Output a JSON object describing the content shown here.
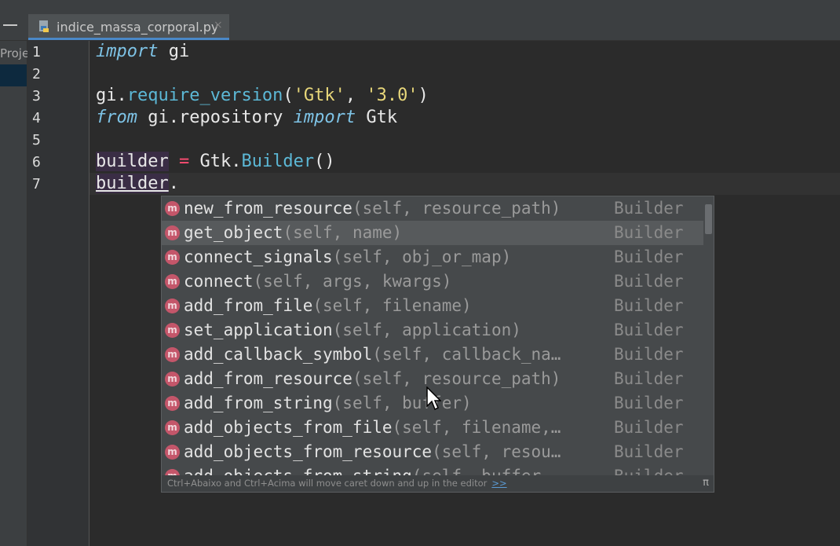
{
  "tab": {
    "filename": "indice_massa_corporal.py",
    "close": "×"
  },
  "sidebar": {
    "project_label": "Proje"
  },
  "editor": {
    "line_numbers": [
      "1",
      "2",
      "3",
      "4",
      "5",
      "6",
      "7"
    ],
    "lines": [
      [
        {
          "t": "import",
          "c": "kw"
        },
        {
          "t": " gi",
          "c": ""
        }
      ],
      [],
      [
        {
          "t": "gi.",
          "c": ""
        },
        {
          "t": "require_version",
          "c": "fn"
        },
        {
          "t": "(",
          "c": ""
        },
        {
          "t": "'Gtk'",
          "c": "str"
        },
        {
          "t": ", ",
          "c": ""
        },
        {
          "t": "'3.0'",
          "c": "str"
        },
        {
          "t": ")",
          "c": ""
        }
      ],
      [
        {
          "t": "from",
          "c": "kw"
        },
        {
          "t": " gi.repository ",
          "c": ""
        },
        {
          "t": "import",
          "c": "kw"
        },
        {
          "t": " Gtk",
          "c": ""
        }
      ],
      [],
      [
        {
          "t": "builder",
          "c": "var-hl"
        },
        {
          "t": " ",
          "c": ""
        },
        {
          "t": "=",
          "c": "op"
        },
        {
          "t": " Gtk.",
          "c": ""
        },
        {
          "t": "Builder",
          "c": "fn"
        },
        {
          "t": "()",
          "c": ""
        }
      ],
      [
        {
          "t": "builder",
          "c": "var-hl ul"
        },
        {
          "t": ".",
          "c": ""
        }
      ]
    ]
  },
  "completion": {
    "badge": "m",
    "items": [
      {
        "name": "new_from_resource",
        "params": "(self, resource_path)",
        "type": "Builder"
      },
      {
        "name": "get_object",
        "params": "(self, name)",
        "type": "Builder",
        "selected": true
      },
      {
        "name": "connect_signals",
        "params": "(self, obj_or_map)",
        "type": "Builder"
      },
      {
        "name": "connect",
        "params": "(self, args, kwargs)",
        "type": "Builder"
      },
      {
        "name": "add_from_file",
        "params": "(self, filename)",
        "type": "Builder"
      },
      {
        "name": "set_application",
        "params": "(self, application)",
        "type": "Builder"
      },
      {
        "name": "add_callback_symbol",
        "params": "(self, callback_na…",
        "type": "Builder"
      },
      {
        "name": "add_from_resource",
        "params": "(self, resource_path)",
        "type": "Builder"
      },
      {
        "name": "add_from_string",
        "params": "(self, buffer)",
        "type": "Builder"
      },
      {
        "name": "add_objects_from_file",
        "params": "(self, filename,…",
        "type": "Builder"
      },
      {
        "name": "add_objects_from_resource",
        "params": "(self, resou…",
        "type": "Builder"
      },
      {
        "name": "add_objects_from_string",
        "params": "(self, buffer…",
        "type": "Builder"
      }
    ],
    "hint": "Ctrl+Abaixo and Ctrl+Acima will move caret down and up in the editor",
    "more_link": ">>",
    "pi": "π"
  },
  "colors": {
    "badge": "#c4566a",
    "keyword": "#7ec3e6",
    "function": "#5cb8d6",
    "string": "#e8d77a",
    "operator": "#ff4d73"
  }
}
